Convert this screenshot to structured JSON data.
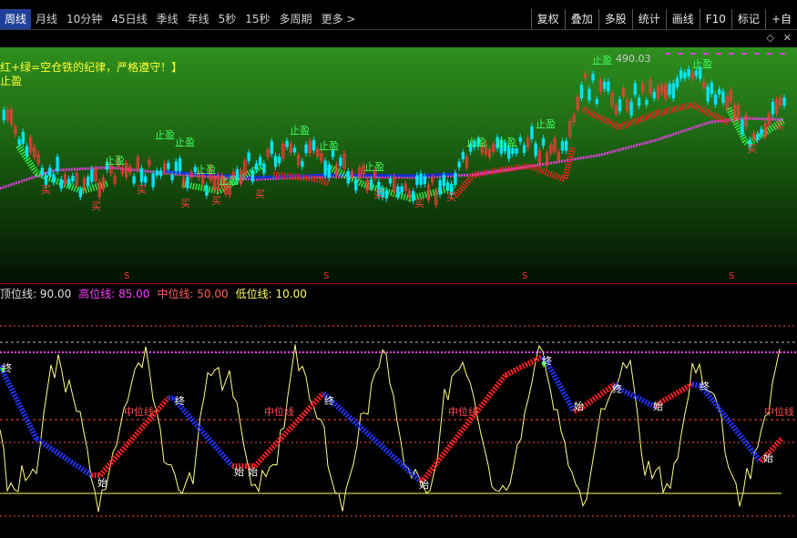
{
  "toolbar": {
    "periods": [
      "周线",
      "月线",
      "10分钟",
      "45日线",
      "季线",
      "年线",
      "5秒",
      "15秒",
      "多周期",
      "更多"
    ],
    "active_period": "周线",
    "more_arrow": ">",
    "tools": [
      "复权",
      "叠加",
      "多股",
      "统计",
      "画线",
      "F10",
      "标记",
      "+自"
    ]
  },
  "strip": {
    "icons": [
      "◇",
      "✕"
    ]
  },
  "main_chart": {
    "tip_text": "红+绿=空仓铁的纪律，严格遵守！】",
    "stop_profit_label": "止盈",
    "high_price": "490.03",
    "buy_label": "买",
    "sell_label": "S",
    "colors": {
      "up": "#ff3b3b",
      "down": "#00e5ff",
      "ribbon_red": "#ff2020",
      "ribbon_green": "#30ff50",
      "ma_magenta": "#e040e0",
      "ma_blue": "#1a2fd0"
    }
  },
  "sub_chart": {
    "legend": {
      "top_line": "顶位线: 90.00",
      "high_line": "高位线: 85.00",
      "mid_line": "中位线: 50.00",
      "low_line": "低位线: 10.00"
    },
    "mid_label": "中位线",
    "start_label": "始",
    "end_label": "终",
    "colors": {
      "osc": "#ffff80",
      "up_band": "#ff2020",
      "down_band": "#2233ff",
      "high": "#ff40ff",
      "mid": "#ff4040",
      "low": "#ffff60",
      "dash": "#ff5050"
    }
  }
}
